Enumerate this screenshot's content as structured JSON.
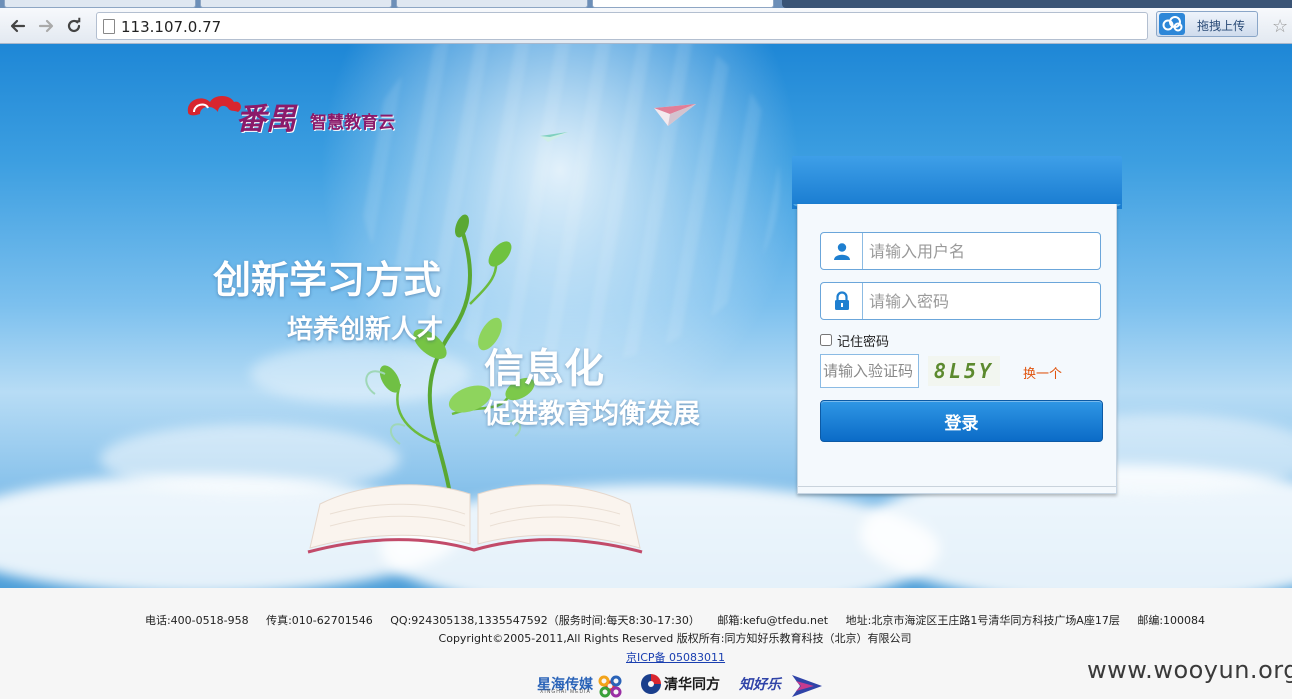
{
  "browser": {
    "url": "113.107.0.77",
    "extension_label": "拖拽上传",
    "star_icon": "☆"
  },
  "brand": {
    "logo_main": "番禺",
    "logo_sub": "智慧教育云"
  },
  "hero": {
    "slogan_1": "创新学习方式",
    "slogan_2": "培养创新人才",
    "slogan_3": "信息化",
    "slogan_4": "促进教育均衡发展"
  },
  "login": {
    "username_placeholder": "请输入用户名",
    "password_placeholder": "请输入密码",
    "remember_label": "记住密码",
    "remember_checked": false,
    "captcha_placeholder": "请输入验证码",
    "captcha_code": "8L5Y",
    "captcha_refresh": "换一个",
    "submit_label": "登录"
  },
  "footer": {
    "phone": "电话:400-0518-958",
    "fax": "传真:010-62701546",
    "qq": "QQ:924305138,1335547592（服务时间:每天8:30-17:30）",
    "email": "邮箱:kefu@tfedu.net",
    "address": "地址:北京市海淀区王庄路1号清华同方科技广场A座17层",
    "postcode": "邮编:100084",
    "copyright": "Copyright©2005-2011,All Rights Reserved 版权所有:同方知好乐教育科技（北京）有限公司",
    "icp": "京ICP备 05083011",
    "partners": [
      "星海传媒",
      "清华同方",
      "知好乐"
    ],
    "partner_sub": "XINGHAI MEDIA",
    "watermark": "www.wooyun.org"
  },
  "colors": {
    "accent": "#1b7ed2",
    "brand": "#8b1a6a",
    "refresh_link": "#e0540e"
  }
}
